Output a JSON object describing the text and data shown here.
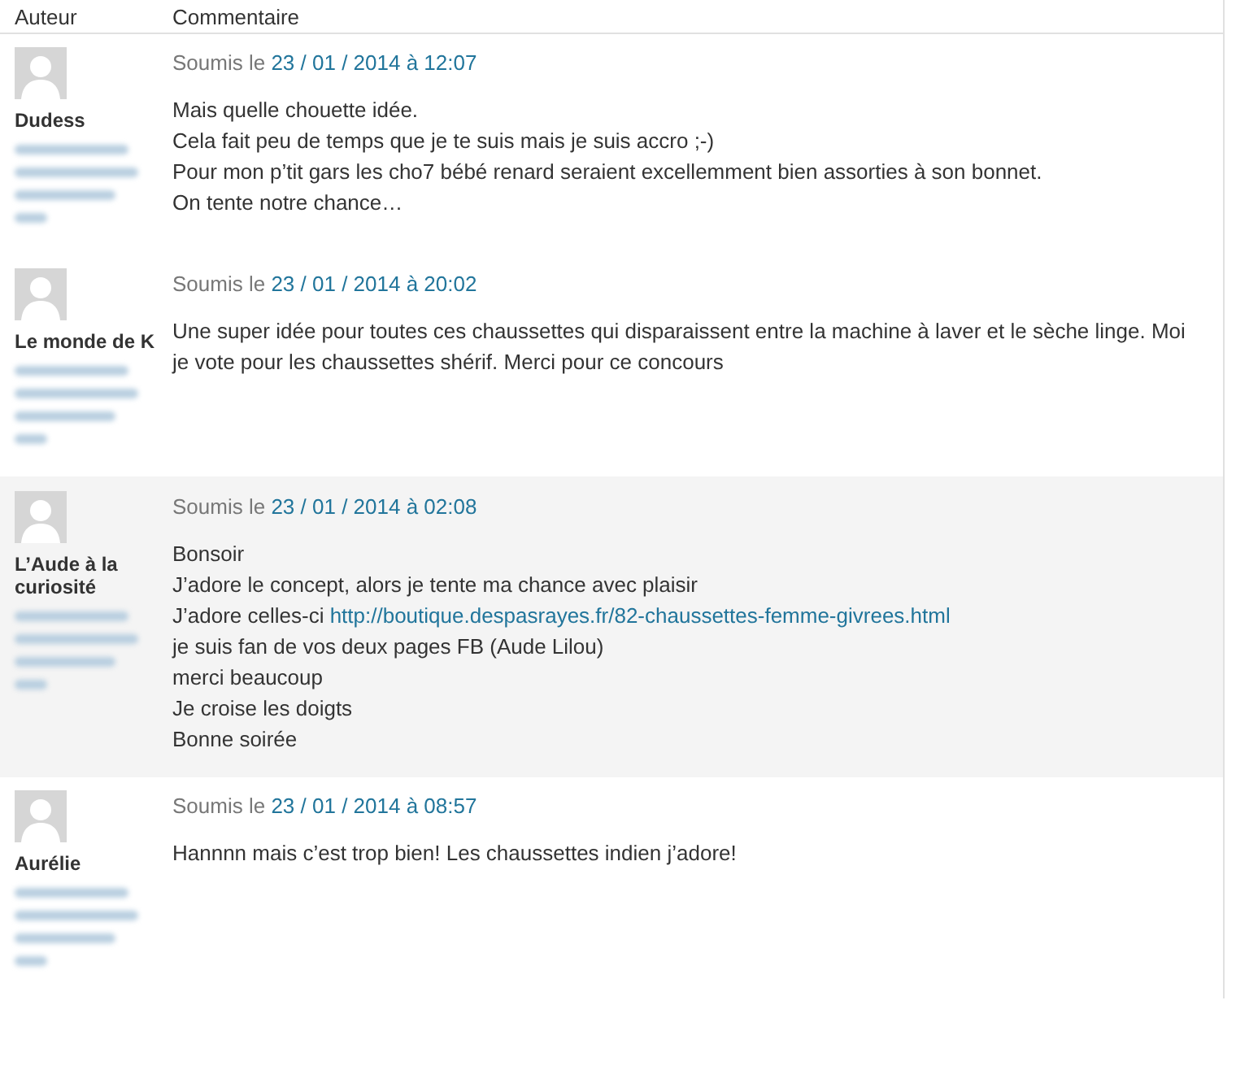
{
  "columns": [
    "Auteur",
    "Commentaire"
  ],
  "comments": [
    {
      "author": "Dudess",
      "submitted_prefix": "Soumis le",
      "date": "23 / 01 / 2014 à 12:07",
      "shaded": false,
      "lines": [
        {
          "text": "Mais quelle chouette idée."
        },
        {
          "text": "Cela fait peu de temps que je te suis mais je suis accro ;-)"
        },
        {
          "text": "Pour mon p’tit gars les cho7 bébé renard seraient excellemment bien assorties à son bonnet."
        },
        {
          "text": "On tente notre chance…"
        }
      ]
    },
    {
      "author": "Le monde de K",
      "submitted_prefix": "Soumis le",
      "date": "23 / 01 / 2014 à 20:02",
      "shaded": false,
      "lines": [
        {
          "text": "Une super idée pour toutes ces chaussettes qui disparaissent entre la machine à laver et le sèche linge. Moi je vote pour les chaussettes shérif. Merci pour ce concours"
        }
      ]
    },
    {
      "author": "L’Aude à la curiosité",
      "submitted_prefix": "Soumis le",
      "date": "23 / 01 / 2014 à 02:08",
      "shaded": true,
      "lines": [
        {
          "text": "Bonsoir"
        },
        {
          "text": "J’adore le concept, alors je tente ma chance avec plaisir"
        },
        {
          "text": "J’adore celles-ci ",
          "link": "http://boutique.despasrayes.fr/82-chaussettes-femme-givrees.html"
        },
        {
          "text": "je suis fan de vos deux pages FB (Aude Lilou)"
        },
        {
          "text": "merci beaucoup"
        },
        {
          "text": "Je croise les doigts"
        },
        {
          "text": "Bonne soirée"
        }
      ]
    },
    {
      "author": "Aurélie",
      "submitted_prefix": "Soumis le",
      "date": "23 / 01 / 2014 à 08:57",
      "shaded": false,
      "lines": [
        {
          "text": "Hannnn mais c’est trop bien! Les chaussettes indien j’adore!"
        }
      ]
    }
  ]
}
